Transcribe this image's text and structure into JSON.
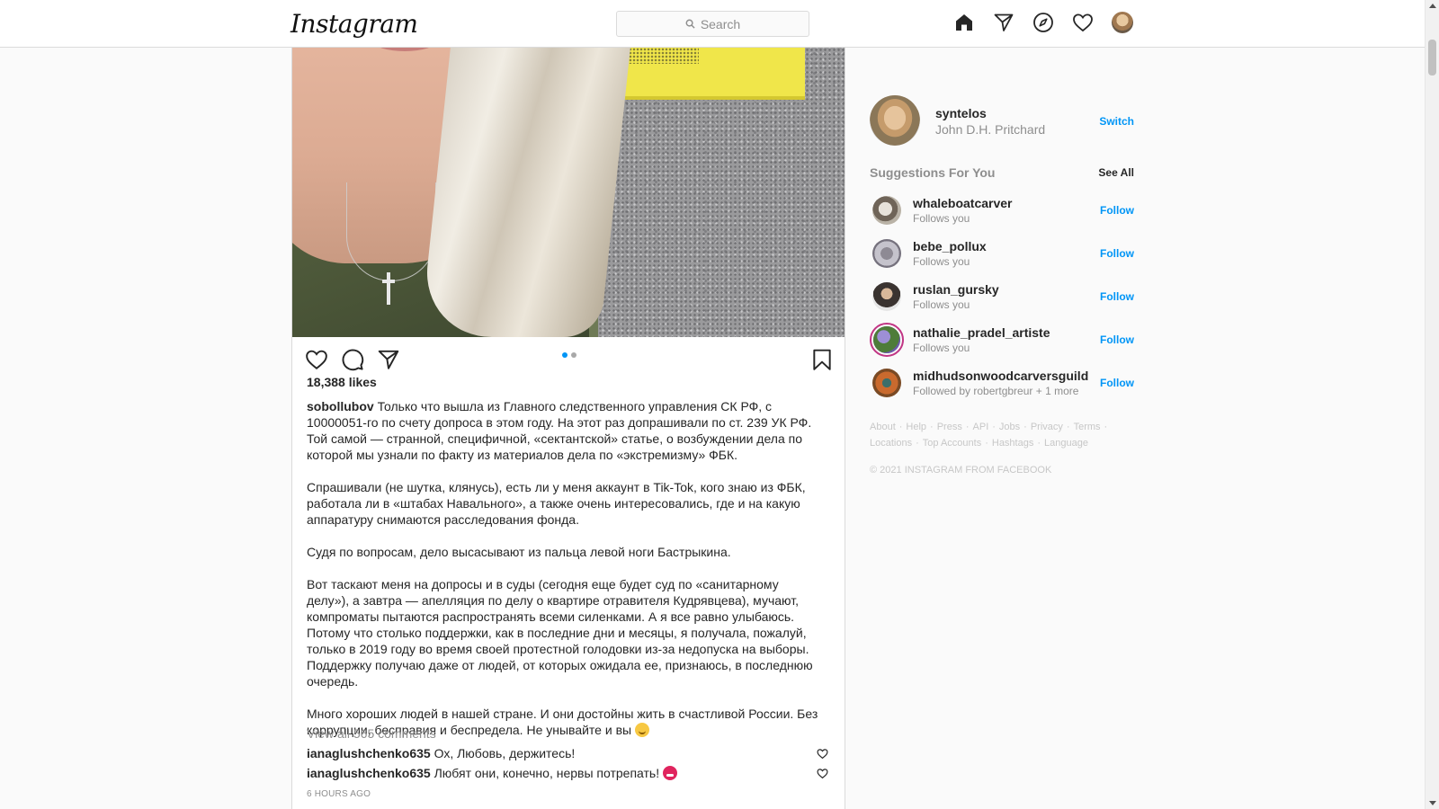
{
  "app": {
    "logo_text": "Instagram"
  },
  "search": {
    "placeholder": "Search"
  },
  "nav": {
    "icons": [
      "home-icon",
      "direct-icon",
      "explore-icon",
      "activity-icon",
      "profile-avatar"
    ]
  },
  "post": {
    "likes": "18,388 likes",
    "carousel": {
      "count": 2,
      "active": 0
    },
    "caption": {
      "username": "sobollubov",
      "paragraphs": [
        "Только что вышла из Главного следственного управления СК РФ, с 10000051-го по счету допроса в этом году. На этот раз допрашивали по ст. 239 УК РФ. Той самой — странной, специфичной, «сектантской» статье, о возбуждении дела по которой мы узнали по факту из материалов дела по «экстремизму» ФБК.",
        "Спрашивали (не шутка, клянусь), есть ли у меня аккаунт в Tik-Tok, кого знаю из ФБК, работала ли в «штабах Навального», а также очень интересовались, где и на какую аппаратуру снимаются расследования фонда.",
        "Судя по вопросам, дело высасывают из пальца левой ноги Бастрыкина.",
        "Вот таскают меня на допросы и в суды (сегодня еще будет суд по «санитарному делу»), а завтра — апелляция по делу о квартире отравителя Кудрявцева), мучают, компроматы пытаются распространять всеми силенками. А я все равно улыбаюсь. Потому что столько поддержки, как в последние дни и месяцы, я получала, пожалуй, только в 2019 году во время своей протестной голодовки из-за недопуска на выборы. Поддержку получаю даже от людей, от которых ожидала ее, признаюсь, в последнюю очередь.",
        "Много хороших людей в нашей стране. И они достойны жить в счастливой России. Без коррупции, бесправия и беспредела. Не унывайте и вы"
      ],
      "end_emoji": "smiling-face"
    },
    "view_comments": "View all 565 comments",
    "comments": [
      {
        "user": "ianaglushchenko635",
        "text": "Ох, Любовь, держитесь!"
      },
      {
        "user": "ianaglushchenko635",
        "text": "Любят они, конечно, нервы потрепать!"
      }
    ],
    "timestamp": "6 HOURS AGO"
  },
  "sidebar": {
    "profile": {
      "username": "syntelos",
      "full_name": "John D.H. Pritchard",
      "switch_label": "Switch"
    },
    "suggestions_title": "Suggestions For You",
    "see_all": "See All",
    "suggestions": [
      {
        "username": "whaleboatcarver",
        "subtitle": "Follows you",
        "follow": "Follow"
      },
      {
        "username": "bebe_pollux",
        "subtitle": "Follows you",
        "follow": "Follow"
      },
      {
        "username": "ruslan_gursky",
        "subtitle": "Follows you",
        "follow": "Follow"
      },
      {
        "username": "nathalie_pradel_artiste",
        "subtitle": "Follows you",
        "follow": "Follow"
      },
      {
        "username": "midhudsonwoodcarversguild",
        "subtitle": "Followed by robertgbreur + 1 more",
        "follow": "Follow"
      }
    ],
    "footer_links": [
      "About",
      "Help",
      "Press",
      "API",
      "Jobs",
      "Privacy",
      "Terms",
      "Locations",
      "Top Accounts",
      "Hashtags",
      "Language"
    ],
    "copyright": "© 2021 INSTAGRAM FROM FACEBOOK"
  },
  "colors": {
    "accent": "#0095f6",
    "muted": "#8e8e8e",
    "border": "#dbdbdb",
    "story_ring": "#c13584"
  }
}
